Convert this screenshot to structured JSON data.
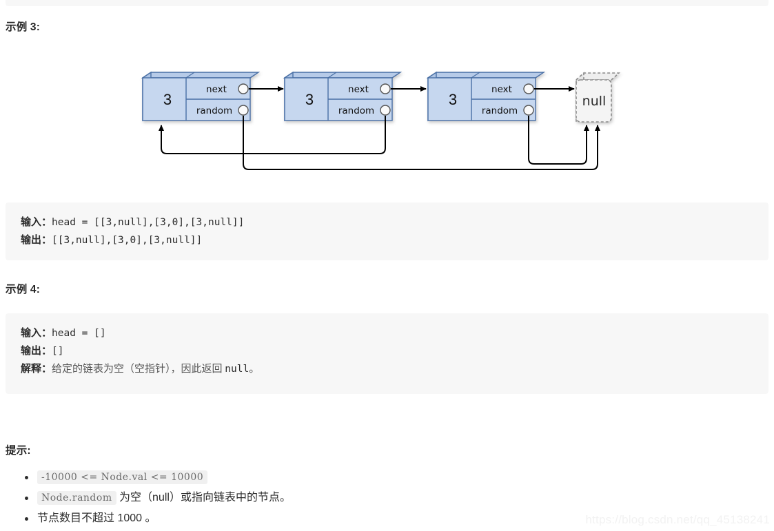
{
  "page": {
    "watermark": "https://blog.csdn.net/qq_45138241"
  },
  "sections": {
    "example3": {
      "heading": "示例 3:",
      "lines": [
        {
          "label": "输入：",
          "code": "head = [[3,null],[3,0],[3,null]]"
        },
        {
          "label": "输出：",
          "code": "[[3,null],[3,0],[3,null]]"
        }
      ]
    },
    "example4": {
      "heading": "示例 4:",
      "lines": [
        {
          "label": "输入：",
          "code": "head = []"
        },
        {
          "label": "输出：",
          "code": "[]"
        },
        {
          "label": "解释：",
          "cn": "给定的链表为空（空指针），因此返回 ",
          "code": "null",
          "cn_tail": "。"
        }
      ]
    },
    "hints": {
      "heading": "提示:",
      "items": [
        {
          "code": "-10000 <= Node.val <= 10000",
          "text": ""
        },
        {
          "code": "Node.random",
          "text": " 为空（null）或指向链表中的节点。"
        },
        {
          "code": "",
          "text": "节点数目不超过 1000 。"
        }
      ]
    }
  },
  "diagram": {
    "type": "linked-list-with-random-pointers",
    "node_fill": "#c6d7ef",
    "node_top_fill": "#b7cbe8",
    "node_side_fill": "#aec4e4",
    "node_stroke": "#4a6fa5",
    "null_fill": "#f4f4f4",
    "null_stroke": "#888888",
    "arrow_color": "#000000",
    "nodes": [
      {
        "value": "3",
        "next_label": "next",
        "random_label": "random"
      },
      {
        "value": "3",
        "next_label": "next",
        "random_label": "random"
      },
      {
        "value": "3",
        "next_label": "next",
        "random_label": "random"
      }
    ],
    "terminal": {
      "label": "null"
    },
    "pointers": {
      "next": [
        "node0->node1",
        "node1->node2",
        "node2->null"
      ],
      "random": [
        "node0->null",
        "node1->node0",
        "node2->null"
      ]
    }
  }
}
